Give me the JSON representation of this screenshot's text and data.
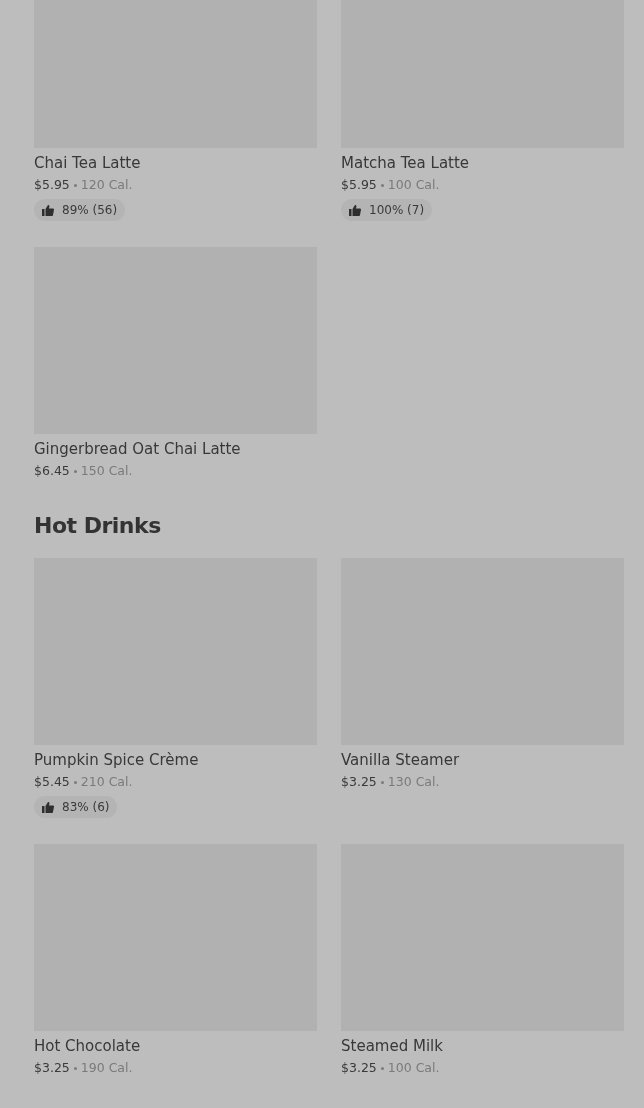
{
  "sections": [
    {
      "items": [
        {
          "name": "Chai Tea Latte",
          "price": "$5.95",
          "calories": "120 Cal.",
          "rating": "89% (56)"
        },
        {
          "name": "Matcha Tea Latte",
          "price": "$5.95",
          "calories": "100 Cal.",
          "rating": "100% (7)"
        },
        {
          "name": "Gingerbread Oat Chai Latte",
          "price": "$6.45",
          "calories": "150 Cal."
        }
      ]
    },
    {
      "title": "Hot Drinks",
      "items": [
        {
          "name": "Pumpkin Spice Crème",
          "price": "$5.45",
          "calories": "210 Cal.",
          "rating": "83% (6)"
        },
        {
          "name": "Vanilla Steamer",
          "price": "$3.25",
          "calories": "130 Cal."
        },
        {
          "name": "Hot Chocolate",
          "price": "$3.25",
          "calories": "190 Cal."
        },
        {
          "name": "Steamed Milk",
          "price": "$3.25",
          "calories": "100 Cal."
        }
      ]
    }
  ]
}
